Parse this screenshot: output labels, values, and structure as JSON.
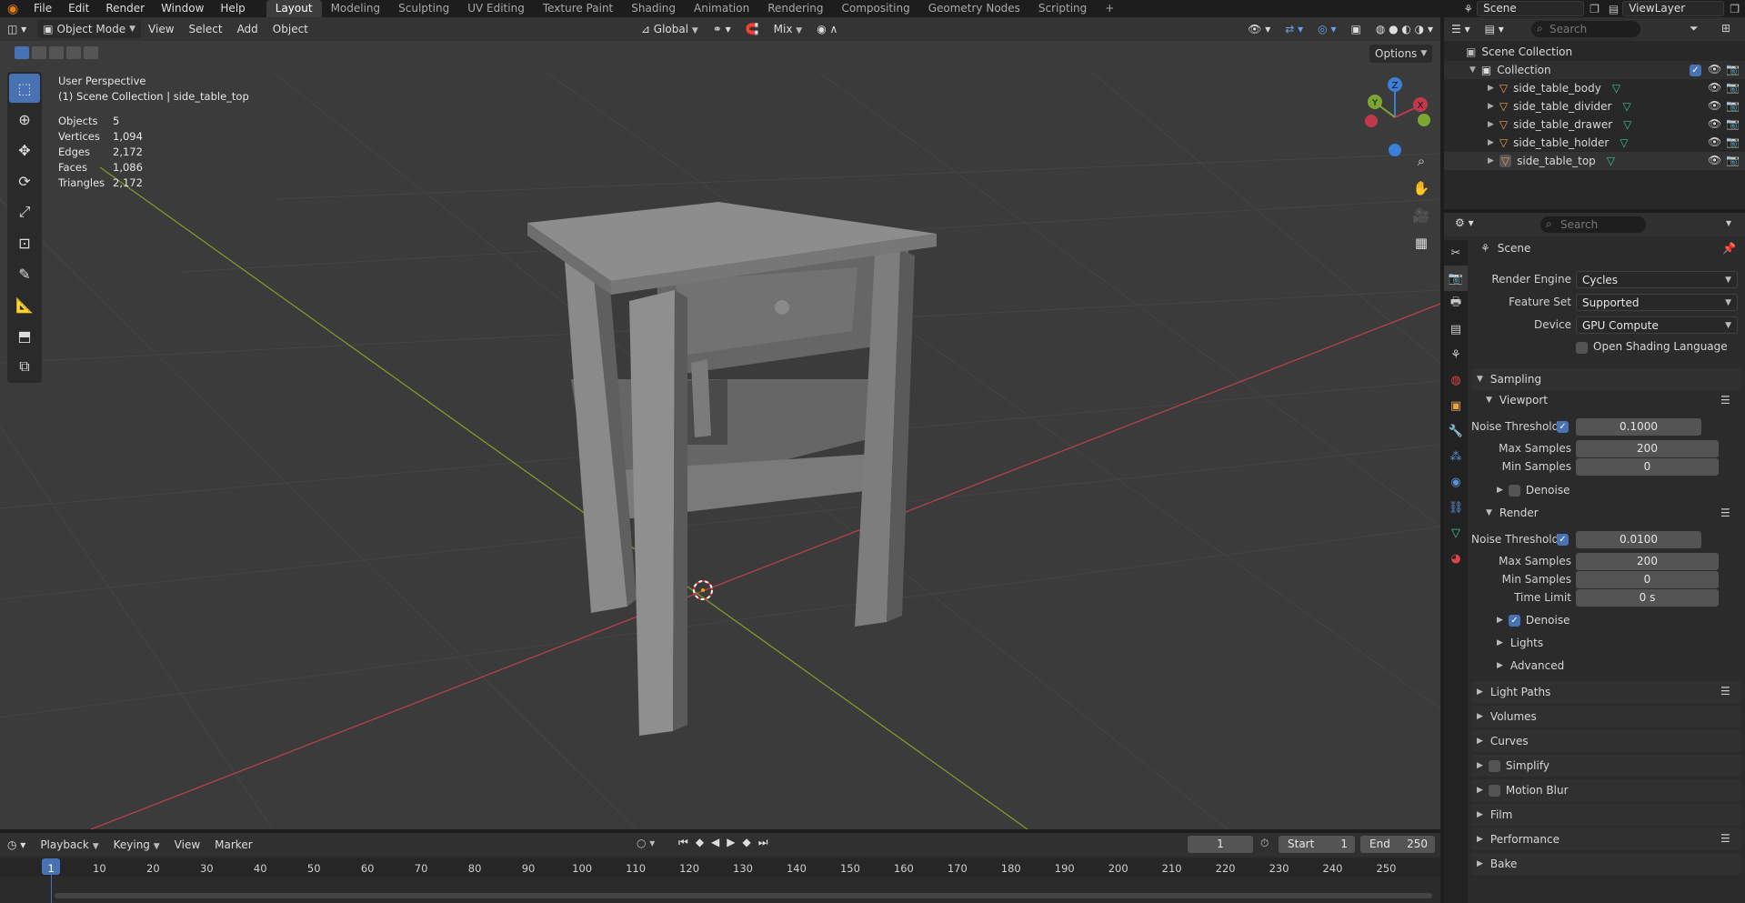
{
  "topbar": {
    "menus": [
      "File",
      "Edit",
      "Render",
      "Window",
      "Help"
    ],
    "workspaces": [
      "Layout",
      "Modeling",
      "Sculpting",
      "UV Editing",
      "Texture Paint",
      "Shading",
      "Animation",
      "Rendering",
      "Compositing",
      "Geometry Nodes",
      "Scripting"
    ],
    "active_workspace": "Layout",
    "add_tab": "+",
    "scene_name": "Scene",
    "view_layer": "ViewLayer"
  },
  "viewport": {
    "mode": "Object Mode",
    "menus": [
      "View",
      "Select",
      "Add",
      "Object"
    ],
    "transform_orientation": "Global",
    "snap_mode": "Mix",
    "options_label": "Options",
    "view_name": "User Perspective",
    "context_path": "(1) Scene Collection | side_table_top",
    "stats": [
      {
        "label": "Objects",
        "value": "5"
      },
      {
        "label": "Vertices",
        "value": "1,094"
      },
      {
        "label": "Edges",
        "value": "2,172"
      },
      {
        "label": "Faces",
        "value": "1,086"
      },
      {
        "label": "Triangles",
        "value": "2,172"
      }
    ],
    "gizmo": {
      "x": "X",
      "y": "Y",
      "z": "Z"
    },
    "colors": {
      "x_axis": "#c0394b",
      "y_axis": "#7ca632",
      "z_axis": "#3b7fd6",
      "background": "#3b3b3b"
    }
  },
  "outliner": {
    "search_placeholder": "Search",
    "root": "Scene Collection",
    "collection": "Collection",
    "objects": [
      "side_table_body",
      "side_table_divider",
      "side_table_drawer",
      "side_table_holder",
      "side_table_top"
    ]
  },
  "properties": {
    "search_placeholder": "Search",
    "context": "Scene",
    "render_engine_label": "Render Engine",
    "render_engine": "Cycles",
    "feature_set_label": "Feature Set",
    "feature_set": "Supported",
    "device_label": "Device",
    "device": "GPU Compute",
    "osl_label": "Open Shading Language",
    "sampling": {
      "title": "Sampling",
      "viewport_title": "Viewport",
      "viewport_noise_label": "Noise Threshold",
      "viewport_noise": "0.1000",
      "viewport_max_label": "Max Samples",
      "viewport_max": "200",
      "viewport_min_label": "Min Samples",
      "viewport_min": "0",
      "viewport_denoise": "Denoise",
      "render_title": "Render",
      "render_noise_label": "Noise Threshold",
      "render_noise": "0.0100",
      "render_max_label": "Max Samples",
      "render_max": "200",
      "render_min_label": "Min Samples",
      "render_min": "0",
      "time_limit_label": "Time Limit",
      "time_limit": "0 s",
      "render_denoise": "Denoise",
      "lights": "Lights",
      "advanced": "Advanced"
    },
    "panels": [
      "Light Paths",
      "Volumes",
      "Curves",
      "Simplify",
      "Motion Blur",
      "Film",
      "Performance",
      "Bake"
    ]
  },
  "timeline": {
    "menus": [
      "Playback",
      "Keying",
      "View",
      "Marker"
    ],
    "current_frame": "1",
    "start_label": "Start",
    "start": "1",
    "end_label": "End",
    "end": "250",
    "ruler": [
      "1",
      "10",
      "20",
      "30",
      "40",
      "50",
      "60",
      "70",
      "80",
      "90",
      "100",
      "110",
      "120",
      "130",
      "140",
      "150",
      "160",
      "170",
      "180",
      "190",
      "200",
      "210",
      "220",
      "230",
      "240",
      "250"
    ]
  }
}
